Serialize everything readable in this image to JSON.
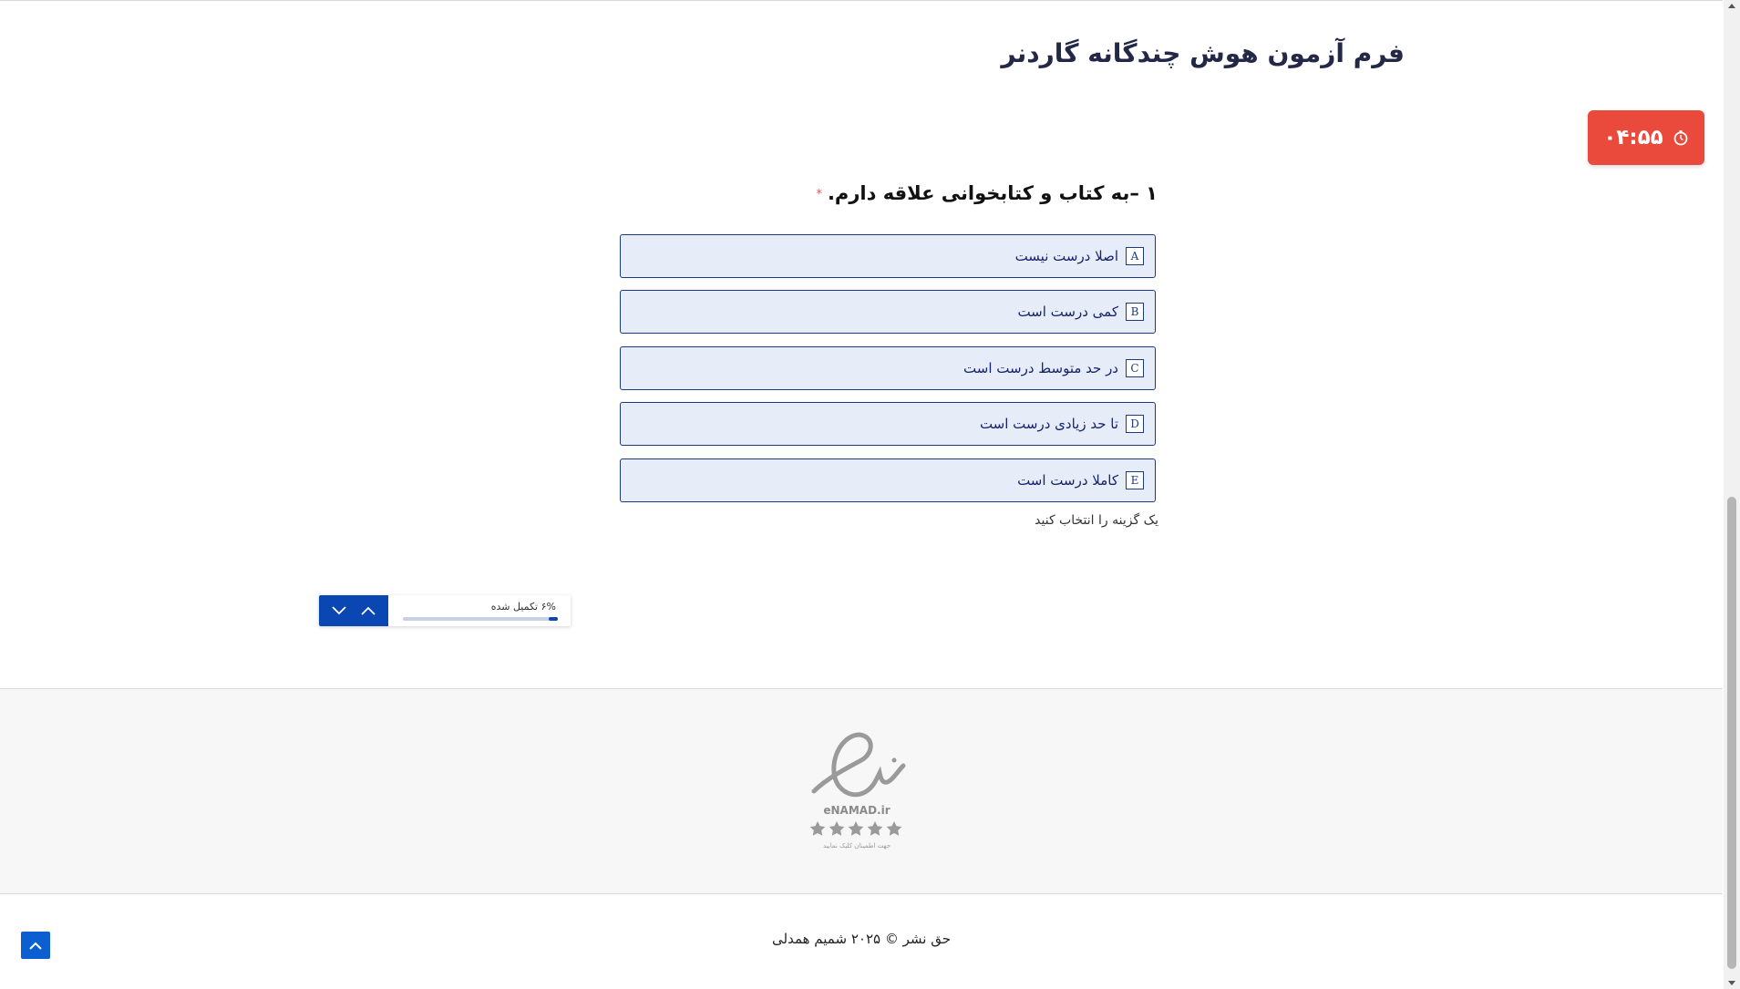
{
  "form": {
    "title": "فرم آزمون هوش چندگانه گاردنر"
  },
  "timer": {
    "time": "۰۴:۵۵",
    "icon": "stopwatch-icon",
    "color": "#ea4a3b"
  },
  "question": {
    "text": "۱ –به کتاب و کتابخوانی علاقه دارم.",
    "required_mark": "*",
    "options": [
      {
        "key": "A",
        "label": "اصلا درست نیست"
      },
      {
        "key": "B",
        "label": "کمی درست است"
      },
      {
        "key": "C",
        "label": "در حد متوسط درست است"
      },
      {
        "key": "D",
        "label": "تا حد زیادی درست است"
      },
      {
        "key": "E",
        "label": "کاملا درست است"
      }
    ],
    "hint": "یک گزینه را انتخاب کنید"
  },
  "progress": {
    "label": "۶% تکمیل شده",
    "fraction": 0.06,
    "accent": "#0b47b3"
  },
  "footer": {
    "badge_domain": "eNAMAD.ir",
    "badge_caption": "جهت اطمینان کلیک نمایید",
    "copyright": "حق نشر © ۲۰۲۵ شمیم همدلی"
  }
}
